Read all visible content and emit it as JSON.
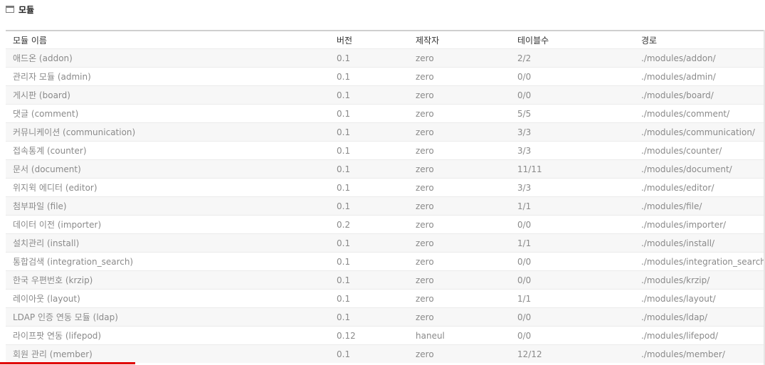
{
  "section": {
    "title": "모듈",
    "icon": "window-icon"
  },
  "table": {
    "headers": {
      "name": "모듈 이름",
      "version": "버전",
      "author": "제작자",
      "tables": "테이블수",
      "path": "경로"
    },
    "rows": [
      {
        "name": "애드온 (addon)",
        "version": "0.1",
        "author": "zero",
        "tables": "2/2",
        "path": "./modules/addon/"
      },
      {
        "name": "관리자 모듈 (admin)",
        "version": "0.1",
        "author": "zero",
        "tables": "0/0",
        "path": "./modules/admin/"
      },
      {
        "name": "게시판 (board)",
        "version": "0.1",
        "author": "zero",
        "tables": "0/0",
        "path": "./modules/board/"
      },
      {
        "name": "댓글 (comment)",
        "version": "0.1",
        "author": "zero",
        "tables": "5/5",
        "path": "./modules/comment/"
      },
      {
        "name": "커뮤니케이션 (communication)",
        "version": "0.1",
        "author": "zero",
        "tables": "3/3",
        "path": "./modules/communication/"
      },
      {
        "name": "접속통계 (counter)",
        "version": "0.1",
        "author": "zero",
        "tables": "3/3",
        "path": "./modules/counter/"
      },
      {
        "name": "문서 (document)",
        "version": "0.1",
        "author": "zero",
        "tables": "11/11",
        "path": "./modules/document/"
      },
      {
        "name": "위지윅 에디터 (editor)",
        "version": "0.1",
        "author": "zero",
        "tables": "3/3",
        "path": "./modules/editor/"
      },
      {
        "name": "첨부파일 (file)",
        "version": "0.1",
        "author": "zero",
        "tables": "1/1",
        "path": "./modules/file/"
      },
      {
        "name": "데이터 이전 (importer)",
        "version": "0.2",
        "author": "zero",
        "tables": "0/0",
        "path": "./modules/importer/"
      },
      {
        "name": "설치관리 (install)",
        "version": "0.1",
        "author": "zero",
        "tables": "1/1",
        "path": "./modules/install/"
      },
      {
        "name": "통합검색 (integration_search)",
        "version": "0.1",
        "author": "zero",
        "tables": "0/0",
        "path": "./modules/integration_search/"
      },
      {
        "name": "한국 우편번호 (krzip)",
        "version": "0.1",
        "author": "zero",
        "tables": "0/0",
        "path": "./modules/krzip/"
      },
      {
        "name": "레이아웃 (layout)",
        "version": "0.1",
        "author": "zero",
        "tables": "1/1",
        "path": "./modules/layout/"
      },
      {
        "name": "LDAP 인증 연동 모듈 (ldap)",
        "version": "0.1",
        "author": "zero",
        "tables": "0/0",
        "path": "./modules/ldap/"
      },
      {
        "name": "라이프팟 연동 (lifepod)",
        "version": "0.12",
        "author": "haneul",
        "tables": "0/0",
        "path": "./modules/lifepod/"
      },
      {
        "name": "회원 관리 (member)",
        "version": "0.1",
        "author": "zero",
        "tables": "12/12",
        "path": "./modules/member/"
      }
    ]
  },
  "colors": {
    "header_text": "#333333",
    "row_text": "#8a8a8a",
    "accent_bar": "#e00000"
  }
}
